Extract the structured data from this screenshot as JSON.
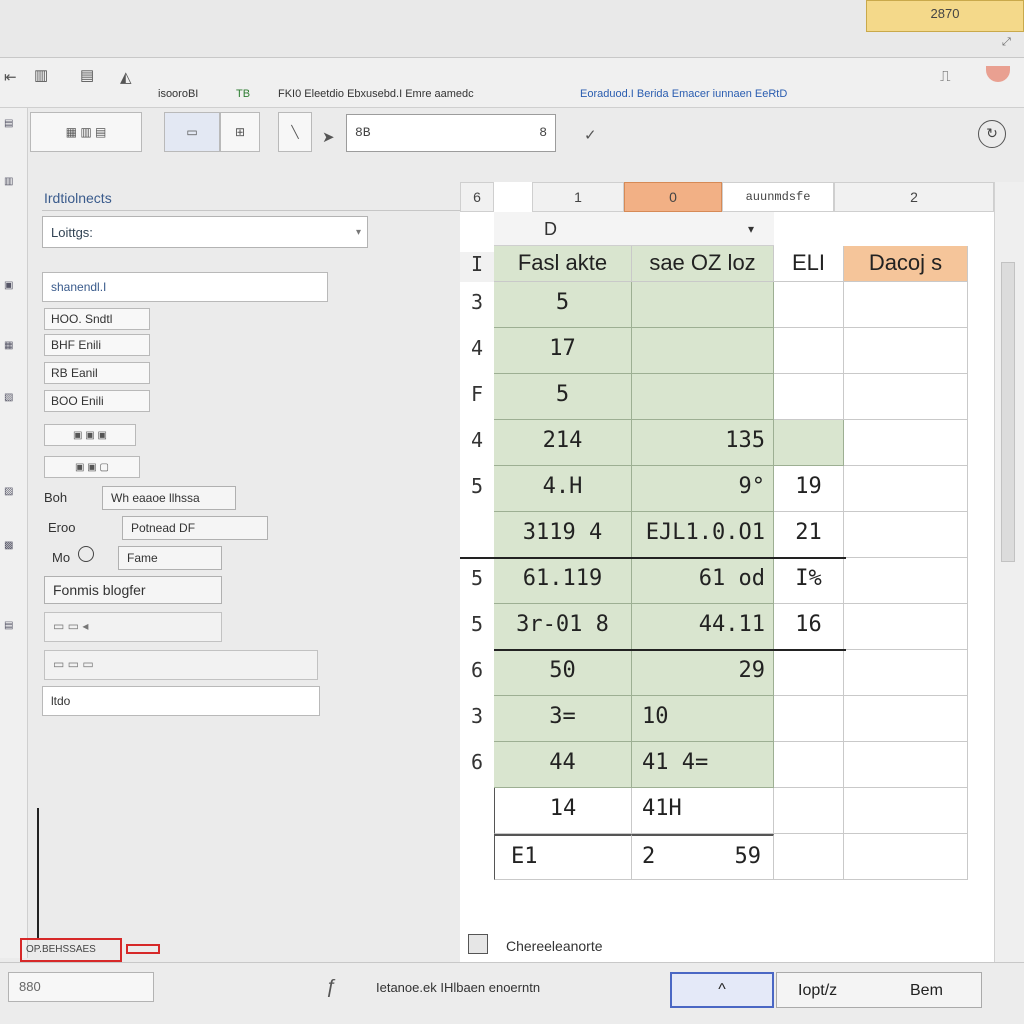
{
  "window": {
    "title_tag": "2870"
  },
  "ribbon": {
    "items": [
      {
        "label": "isooroBI"
      },
      {
        "label": "TB"
      },
      {
        "label": "FKI0 Eleetdio Ebxusebd.I Emre aamedc"
      },
      {
        "label": "Eoraduod.I Berida Emacer iunnaen EeRtD"
      }
    ]
  },
  "toolbar": {
    "name_box": "8B",
    "name_box_suffix": "8"
  },
  "pane": {
    "title": "Irdtiolnects",
    "search_value": "Loittgs:",
    "field_main": "shanendl.I",
    "options": [
      "HOO. Sndtl",
      "BHF Enili",
      "RB Eanil",
      "BOO Enili"
    ],
    "label_1": "Boh",
    "label_1_value": "Wh eaaoe llhssa",
    "label_2": "Eroo",
    "label_2_value": "Potnead DF",
    "label_3": "Mo",
    "label_3_value": "Fame",
    "section_title": "Fonmis blogfer",
    "bottom_field": "ltdo"
  },
  "sheet": {
    "columns": [
      {
        "label": "6"
      },
      {
        "label": "1"
      },
      {
        "label": "0"
      },
      {
        "label": "auunmdsfe"
      },
      {
        "label": "2"
      }
    ],
    "sub_header": "D",
    "header_row": {
      "row_label": "I",
      "cells": [
        "Fasl akte",
        "sae OZ loz",
        "ELI",
        "Dacoj s"
      ]
    },
    "rows": [
      {
        "row": "3",
        "a": "5",
        "b": "",
        "c": "",
        "d": ""
      },
      {
        "row": "4",
        "a": "17",
        "b": "",
        "c": "",
        "d": ""
      },
      {
        "row": "F",
        "a": "5",
        "b": "",
        "c": "",
        "d": ""
      },
      {
        "row": "4",
        "a": "214",
        "b": "135",
        "c": "",
        "d": ""
      },
      {
        "row": "5",
        "a": "4.H",
        "b": "9°",
        "c": "19",
        "d": ""
      },
      {
        "row": "",
        "a": "3119 4",
        "b": "EJL1.0.O1",
        "c": "21",
        "d": ""
      },
      {
        "row": "5",
        "a": "61.119",
        "b": "61 od",
        "c": "I%",
        "d": ""
      },
      {
        "row": "5",
        "a": "3r-01 8",
        "b": "44.11",
        "c": "16",
        "d": ""
      },
      {
        "row": "6",
        "a": "50",
        "b": "29",
        "c": "",
        "d": ""
      },
      {
        "row": "3",
        "a": "3=",
        "b": "10",
        "c": "",
        "d": ""
      },
      {
        "row": "6",
        "a": "44",
        "b": "41 4=",
        "c": "",
        "d": ""
      },
      {
        "row": "",
        "a": "14",
        "b": "41H",
        "c": "",
        "d": ""
      },
      {
        "row": "",
        "a": "E1",
        "b": "2",
        "b2": "59",
        "c": "",
        "d": ""
      }
    ],
    "tab_label": "Chereeleanorte"
  },
  "status": {
    "cell_ref": "880",
    "text": "Ietanoe.ek IHlbaen enoerntn",
    "btn_up": "^",
    "btn_left": "Iopt/z",
    "btn_right": "Bem",
    "red_label": "OP.BEHSSAES"
  },
  "colors": {
    "green_cell": "#d9e5cf",
    "orange_header": "#f2b085",
    "accent_blue": "#4a67c4",
    "red_mark": "#d62828"
  }
}
